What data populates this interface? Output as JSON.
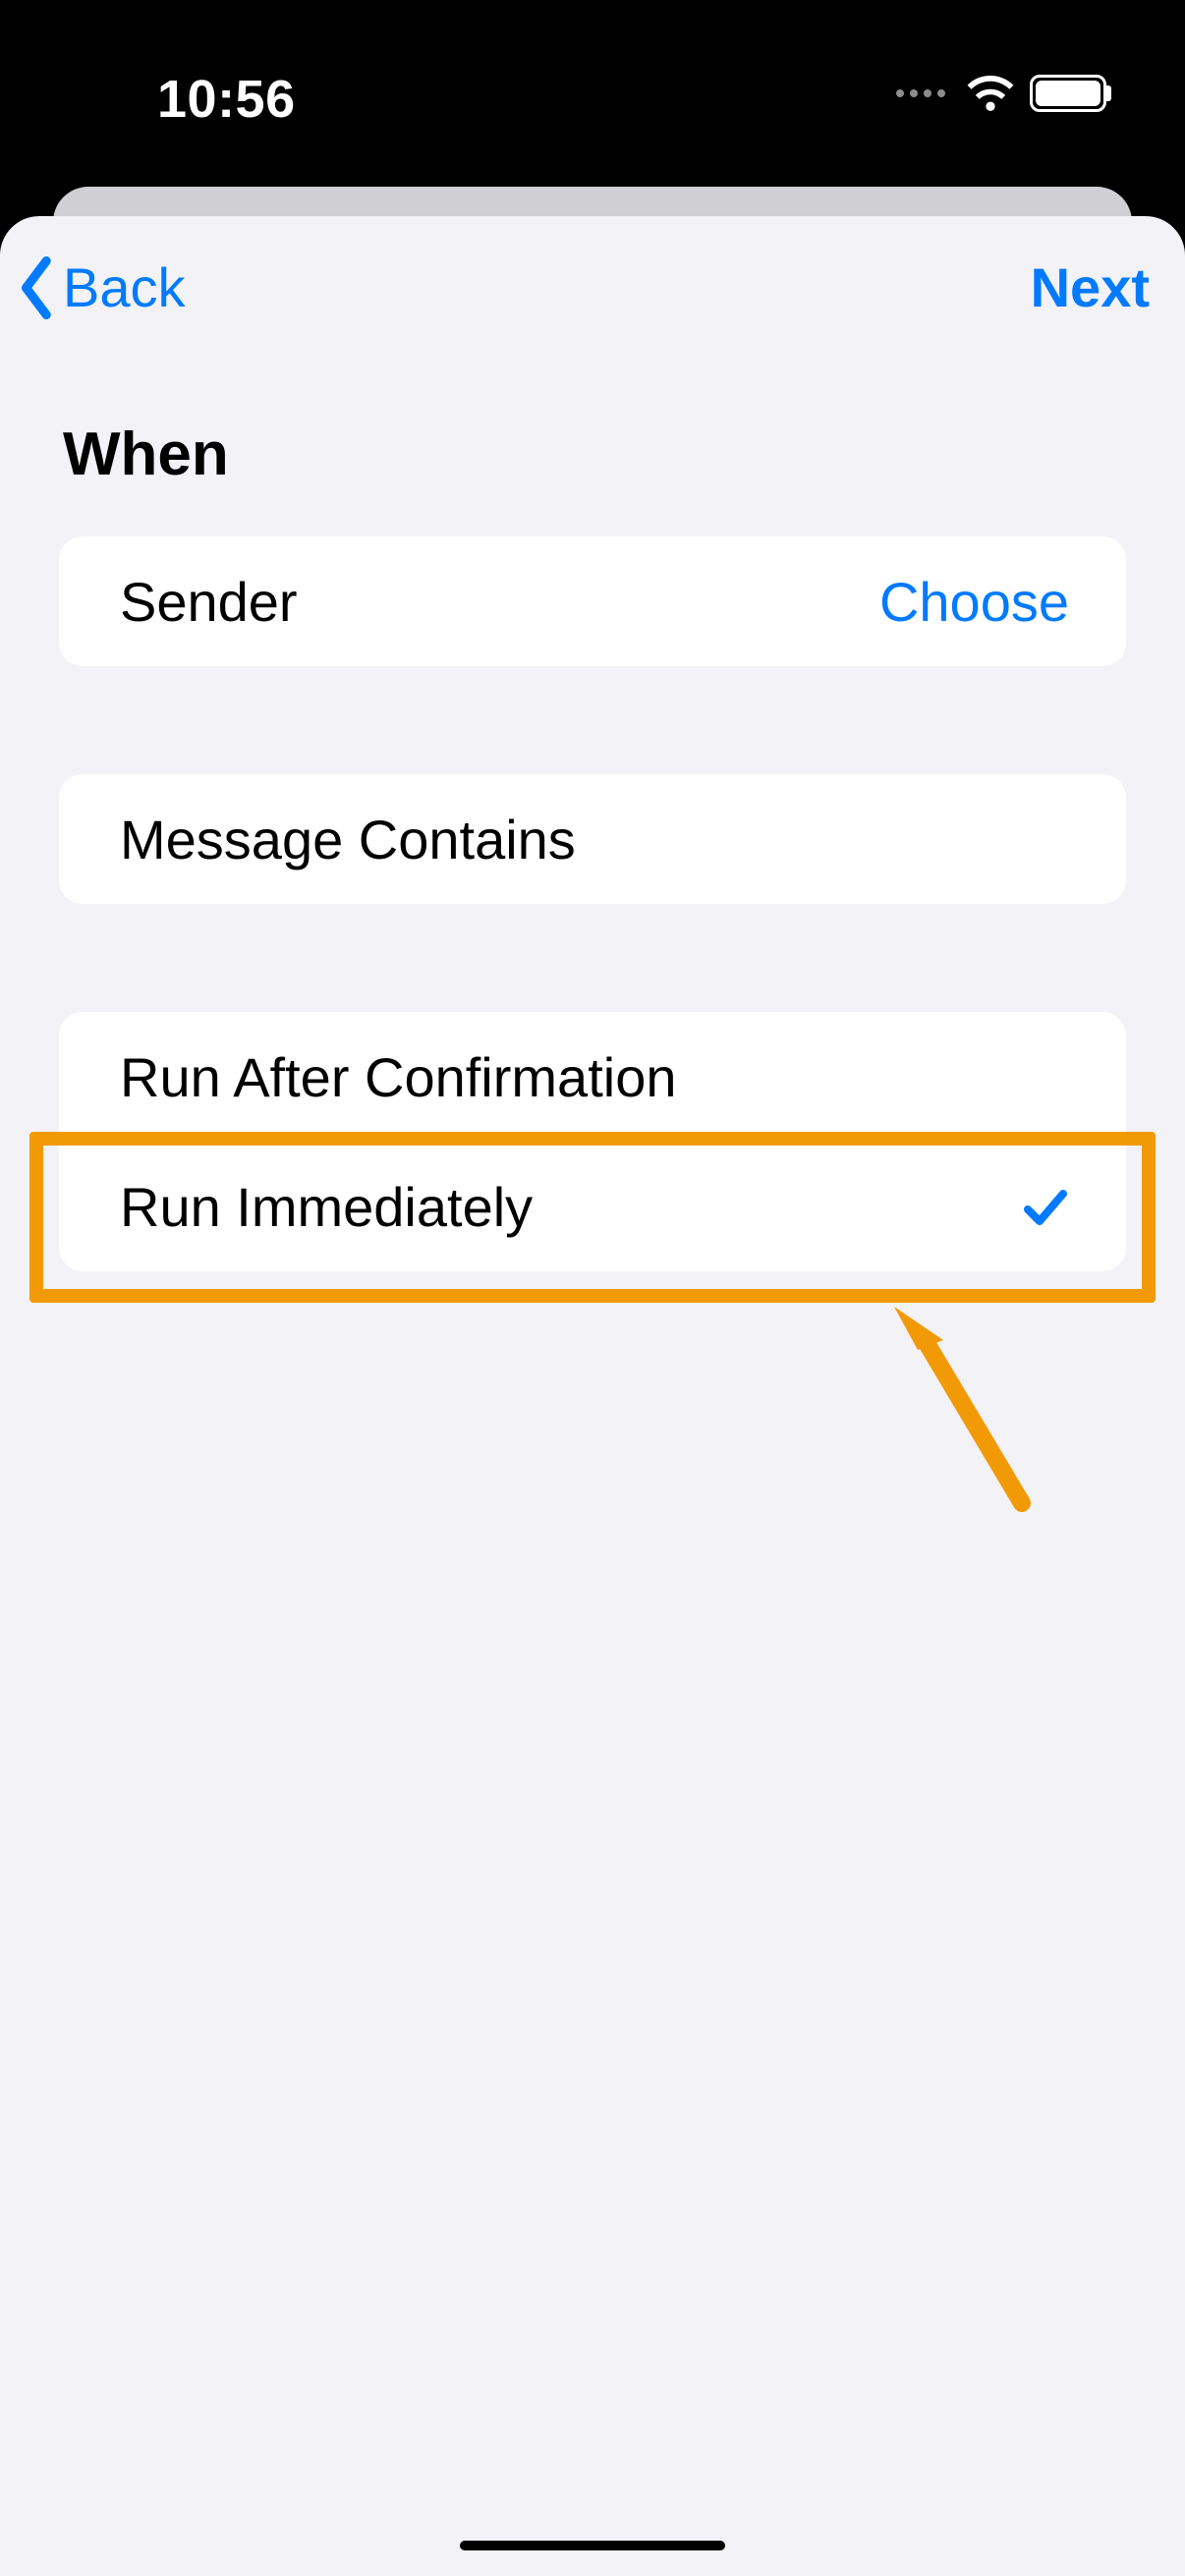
{
  "status": {
    "time": "10:56"
  },
  "nav": {
    "back_label": "Back",
    "next_label": "Next"
  },
  "section": {
    "title": "When"
  },
  "group1": {
    "sender_label": "Sender",
    "sender_action": "Choose"
  },
  "group2": {
    "message_contains_label": "Message Contains"
  },
  "group3": {
    "run_after_confirmation_label": "Run After Confirmation",
    "run_immediately_label": "Run Immediately"
  },
  "colors": {
    "accent": "#007aff",
    "annotation": "#f29a06"
  }
}
